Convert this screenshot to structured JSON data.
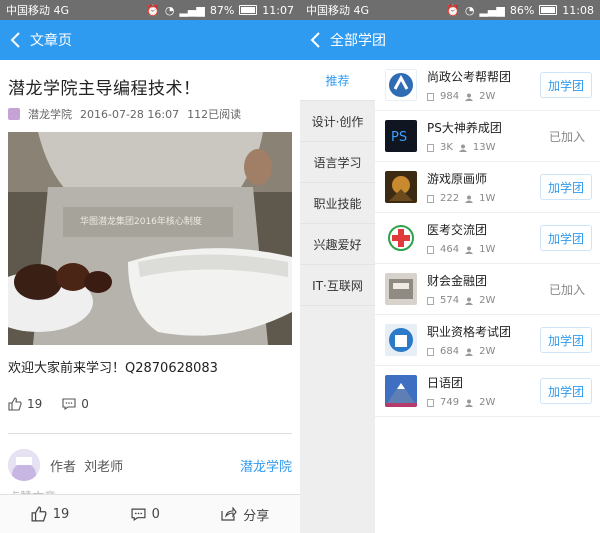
{
  "left": {
    "status": {
      "carrier": "中国移动 4G",
      "battery": "87%",
      "time": "11:07",
      "battery_level": 0.87
    },
    "nav": {
      "title": "文章页"
    },
    "article": {
      "title": "潜龙学院主导编程技术！",
      "author_name": "潜龙学院",
      "date": "2016-07-28 16:07",
      "read_count": "112已阅读",
      "image_text": "华图潜龙集团2016年核心制度",
      "body": "欢迎大家前来学习！Q2870628083",
      "likes": "19",
      "comments": "0",
      "author_prefix": "作者",
      "author_teacher": "刘老师",
      "author_link": "潜龙学院",
      "faded": "点赞文章"
    },
    "bottom": {
      "likes": "19",
      "comments": "0",
      "share": "分享"
    }
  },
  "right": {
    "status": {
      "carrier": "中国移动 4G",
      "battery": "86%",
      "time": "11:08",
      "battery_level": 0.86
    },
    "nav": {
      "title": "全部学团"
    },
    "categories": [
      {
        "label": "推荐",
        "active": true
      },
      {
        "label": "设计·创作"
      },
      {
        "label": "语言学习"
      },
      {
        "label": "职业技能"
      },
      {
        "label": "兴趣爱好"
      },
      {
        "label": "IT·互联网"
      }
    ],
    "groups": [
      {
        "name": "尚政公考帮帮团",
        "posts": "984",
        "members": "2W",
        "action": "加学团",
        "joined": false,
        "icon": "shangzheng-logo-icon"
      },
      {
        "name": "PS大神养成团",
        "posts": "3K",
        "members": "13W",
        "action": "已加入",
        "joined": true,
        "icon": "ps-logo-icon"
      },
      {
        "name": "游戏原画师",
        "posts": "222",
        "members": "1W",
        "action": "加学团",
        "joined": false,
        "icon": "game-art-icon"
      },
      {
        "name": "医考交流团",
        "posts": "464",
        "members": "1W",
        "action": "加学团",
        "joined": false,
        "icon": "medical-cross-icon"
      },
      {
        "name": "财会金融团",
        "posts": "574",
        "members": "2W",
        "action": "已加入",
        "joined": true,
        "icon": "finance-icon"
      },
      {
        "name": "职业资格考试团",
        "posts": "684",
        "members": "2W",
        "action": "加学团",
        "joined": false,
        "icon": "exam-icon"
      },
      {
        "name": "日语团",
        "posts": "749",
        "members": "2W",
        "action": "加学团",
        "joined": false,
        "icon": "mount-fuji-icon"
      }
    ]
  }
}
